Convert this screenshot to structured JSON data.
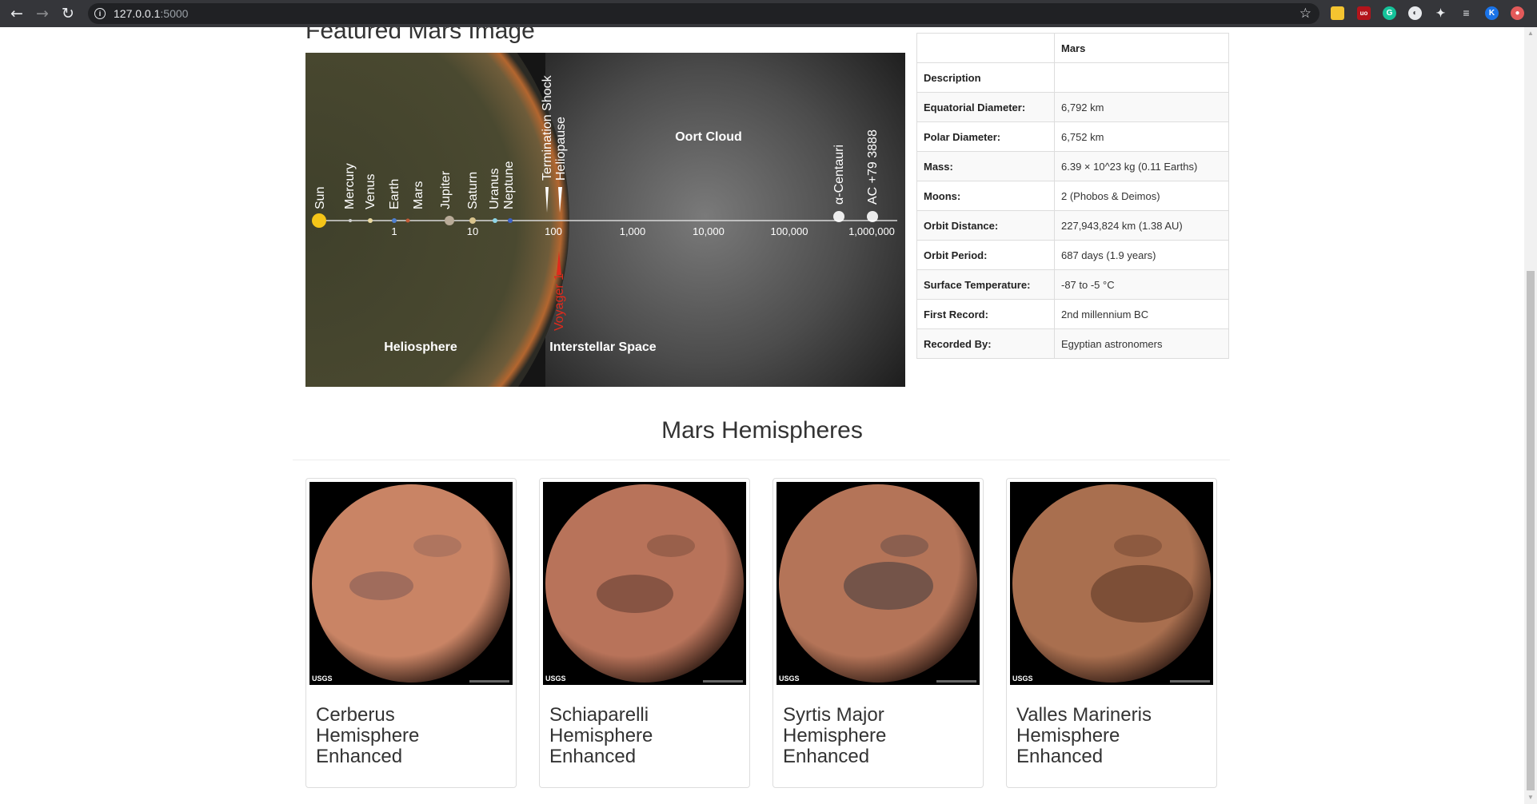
{
  "browser": {
    "url_host": "127.0.0.1",
    "url_port": ":5000",
    "profile_initial": "K"
  },
  "featured": {
    "title": "Featured Mars Image",
    "diagram": {
      "bodies": [
        "Sun",
        "Mercury",
        "Venus",
        "Earth",
        "Mars",
        "Jupiter",
        "Saturn",
        "Uranus",
        "Neptune"
      ],
      "boundaries": [
        "Termination Shock",
        "Heliopause"
      ],
      "far_objects": [
        "α-Centauri",
        "AC +79 3888"
      ],
      "scale_labels": [
        "1",
        "10",
        "100",
        "1,000",
        "10,000",
        "100,000",
        "1,000,000"
      ],
      "regions": {
        "cloud": "Oort Cloud",
        "helio": "Heliosphere",
        "interstellar": "Interstellar Space"
      },
      "probe": "Voyager 1"
    }
  },
  "facts": {
    "header_left": "",
    "header_right": "Mars",
    "rows": [
      {
        "label": "Description",
        "value": ""
      },
      {
        "label": "Equatorial Diameter:",
        "value": "6,792 km"
      },
      {
        "label": "Polar Diameter:",
        "value": "6,752 km"
      },
      {
        "label": "Mass:",
        "value": "6.39 × 10^23 kg (0.11 Earths)"
      },
      {
        "label": "Moons:",
        "value": "2 (Phobos & Deimos)"
      },
      {
        "label": "Orbit Distance:",
        "value": "227,943,824 km (1.38 AU)"
      },
      {
        "label": "Orbit Period:",
        "value": "687 days (1.9 years)"
      },
      {
        "label": "Surface Temperature:",
        "value": "-87 to -5 °C"
      },
      {
        "label": "First Record:",
        "value": "2nd millennium BC"
      },
      {
        "label": "Recorded By:",
        "value": "Egyptian astronomers"
      }
    ]
  },
  "hemispheres": {
    "title": "Mars Hemispheres",
    "logo_text": "USGS",
    "cards": [
      {
        "title": "Cerberus Hemisphere Enhanced",
        "color_main": "#c98465",
        "color_dark": "#7d5a56"
      },
      {
        "title": "Schiaparelli Hemisphere Enhanced",
        "color_main": "#b8735a",
        "color_dark": "#5e3b32"
      },
      {
        "title": "Syrtis Major Hemisphere Enhanced",
        "color_main": "#b47458",
        "color_dark": "#3f3a3e"
      },
      {
        "title": "Valles Marineris Hemisphere Enhanced",
        "color_main": "#a96f4f",
        "color_dark": "#5a3524"
      }
    ]
  }
}
